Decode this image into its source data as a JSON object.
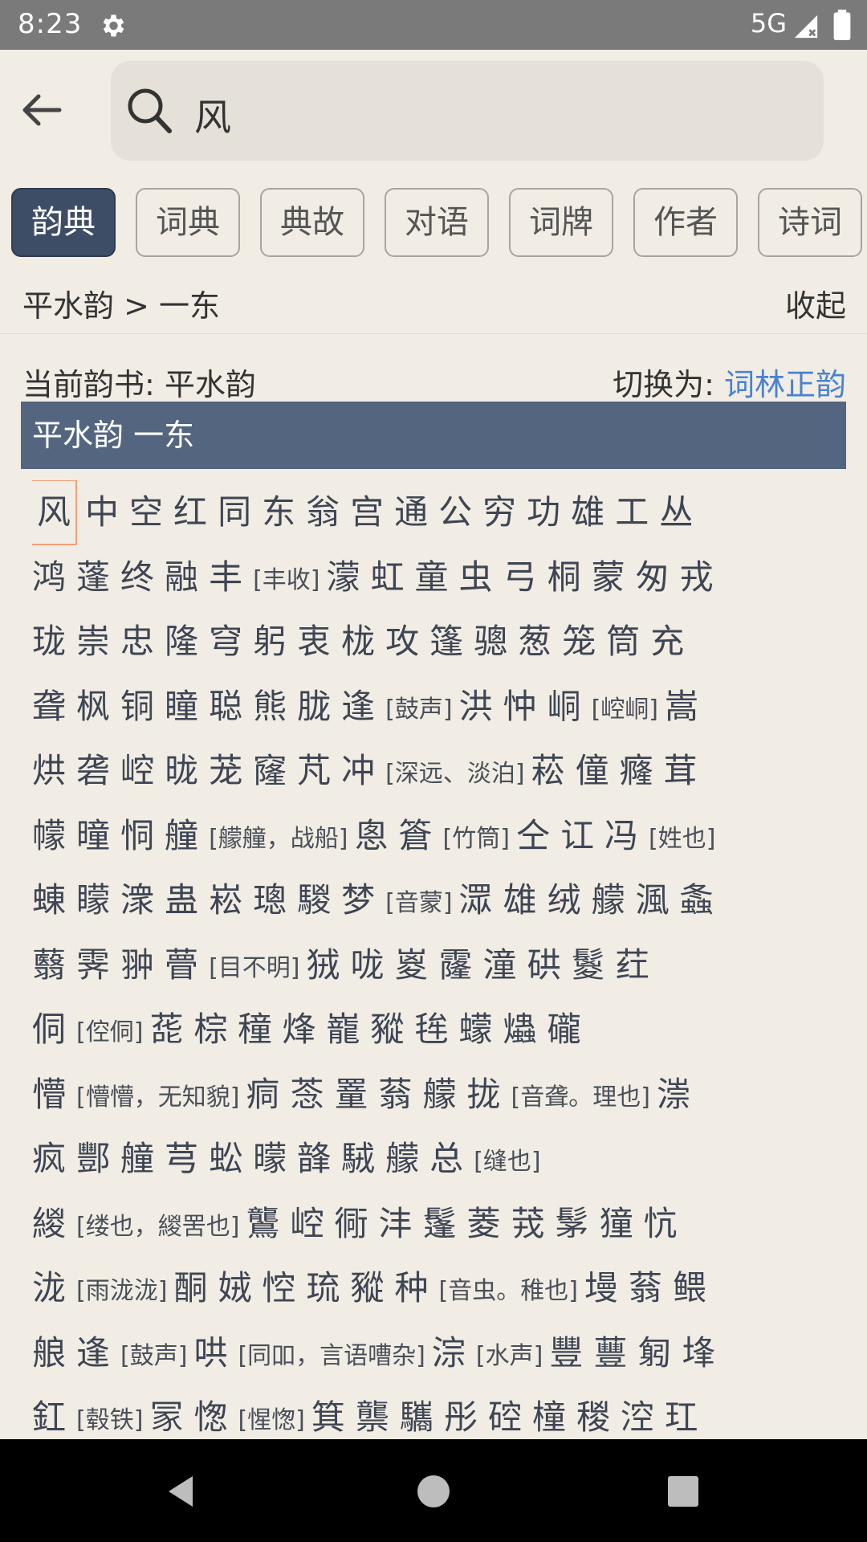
{
  "status": {
    "time": "8:23",
    "network": "5G"
  },
  "search": {
    "value": "风"
  },
  "tabs": [
    "韵典",
    "词典",
    "典故",
    "对语",
    "词牌",
    "作者",
    "诗词"
  ],
  "breadcrumb": "平水韵 > 一东",
  "collapse_label": "收起",
  "current_book": "当前韵书: 平水韵",
  "switch_label": "切换为:",
  "switch_link": "词林正韵",
  "section_title": "平水韵 一东",
  "rows": [
    [
      {
        "c": "风",
        "sel": true
      },
      {
        "c": "中"
      },
      {
        "c": "空"
      },
      {
        "c": "红"
      },
      {
        "c": "同"
      },
      {
        "c": "东"
      },
      {
        "c": "翁"
      },
      {
        "c": "宫"
      },
      {
        "c": "通"
      },
      {
        "c": "公"
      },
      {
        "c": "穷"
      },
      {
        "c": "功"
      },
      {
        "c": "雄"
      },
      {
        "c": "工"
      },
      {
        "c": "丛"
      }
    ],
    [
      {
        "c": "鸿"
      },
      {
        "c": "蓬"
      },
      {
        "c": "终"
      },
      {
        "c": "融"
      },
      {
        "c": "丰"
      },
      {
        "n": "[丰收]"
      },
      {
        "c": "濛"
      },
      {
        "c": "虹"
      },
      {
        "c": "童"
      },
      {
        "c": "虫"
      },
      {
        "c": "弓"
      },
      {
        "c": "桐"
      },
      {
        "c": "蒙"
      },
      {
        "c": "匆"
      },
      {
        "c": "戎"
      }
    ],
    [
      {
        "c": "珑"
      },
      {
        "c": "崇"
      },
      {
        "c": "忠"
      },
      {
        "c": "隆"
      },
      {
        "c": "穹"
      },
      {
        "c": "躬"
      },
      {
        "c": "衷"
      },
      {
        "c": "栊"
      },
      {
        "c": "攻"
      },
      {
        "c": "篷"
      },
      {
        "c": "骢"
      },
      {
        "c": "葱"
      },
      {
        "c": "笼"
      },
      {
        "c": "筒"
      },
      {
        "c": "充"
      }
    ],
    [
      {
        "c": "聋"
      },
      {
        "c": "枫"
      },
      {
        "c": "铜"
      },
      {
        "c": "瞳"
      },
      {
        "c": "聪"
      },
      {
        "c": "熊"
      },
      {
        "c": "胧"
      },
      {
        "c": "逢"
      },
      {
        "n": "[鼓声]"
      },
      {
        "c": "洪"
      },
      {
        "c": "忡"
      },
      {
        "c": "峒"
      },
      {
        "n": "[崆峒]"
      },
      {
        "c": "嵩"
      }
    ],
    [
      {
        "c": "烘"
      },
      {
        "c": "砻"
      },
      {
        "c": "崆"
      },
      {
        "c": "昽"
      },
      {
        "c": "茏"
      },
      {
        "c": "窿"
      },
      {
        "c": "芃"
      },
      {
        "c": "冲"
      },
      {
        "n": "[深远、淡泊]"
      },
      {
        "c": "菘"
      },
      {
        "c": "僮"
      },
      {
        "c": "癃"
      },
      {
        "c": "茸"
      }
    ],
    [
      {
        "c": "幪"
      },
      {
        "c": "曈"
      },
      {
        "c": "恫"
      },
      {
        "c": "艟"
      },
      {
        "n": "[艨艟，战船]"
      },
      {
        "c": "悤"
      },
      {
        "c": "篬"
      },
      {
        "n": "[竹筒]"
      },
      {
        "c": "仝"
      },
      {
        "c": "讧"
      },
      {
        "c": "冯"
      },
      {
        "n": "[姓也]"
      }
    ],
    [
      {
        "c": "蝀"
      },
      {
        "c": "矇"
      },
      {
        "c": "潨"
      },
      {
        "c": "蛊"
      },
      {
        "c": "崧"
      },
      {
        "c": "璁"
      },
      {
        "c": "騣"
      },
      {
        "c": "梦"
      },
      {
        "n": "[音蒙]"
      },
      {
        "c": "潀"
      },
      {
        "c": "雄"
      },
      {
        "c": "绒"
      },
      {
        "c": "艨"
      },
      {
        "c": "渢"
      },
      {
        "c": "螽"
      }
    ],
    [
      {
        "c": "蘙"
      },
      {
        "c": "霁"
      },
      {
        "c": "翀"
      },
      {
        "c": "瞢"
      },
      {
        "n": "[目不明]"
      },
      {
        "c": "狨"
      },
      {
        "c": "咙"
      },
      {
        "c": "嵏"
      },
      {
        "c": "霳"
      },
      {
        "c": "潼"
      },
      {
        "c": "硔"
      },
      {
        "c": "鬉"
      },
      {
        "c": "荭"
      }
    ],
    [
      {
        "c": "侗"
      },
      {
        "n": "[倥侗]"
      },
      {
        "c": "蒊"
      },
      {
        "c": "棕"
      },
      {
        "c": "穜"
      },
      {
        "c": "烽"
      },
      {
        "c": "巃"
      },
      {
        "c": "豵"
      },
      {
        "c": "毪"
      },
      {
        "c": "蠓"
      },
      {
        "c": "爞"
      },
      {
        "c": "礲"
      }
    ],
    [
      {
        "c": "懵"
      },
      {
        "n": "[懵懵，无知貌]"
      },
      {
        "c": "痌"
      },
      {
        "c": "菍"
      },
      {
        "c": "罿"
      },
      {
        "c": "蓊"
      },
      {
        "c": "艨"
      },
      {
        "c": "拢"
      },
      {
        "n": "[音聋。理也]"
      },
      {
        "c": "漴"
      }
    ],
    [
      {
        "c": "疯"
      },
      {
        "c": "酆"
      },
      {
        "c": "艟"
      },
      {
        "c": "芎"
      },
      {
        "c": "蚣"
      },
      {
        "c": "曚"
      },
      {
        "c": "韸"
      },
      {
        "c": "駥"
      },
      {
        "c": "艨"
      },
      {
        "c": "总"
      },
      {
        "n": "[缝也]"
      }
    ],
    [
      {
        "c": "緵"
      },
      {
        "n": "[缕也，緵罟也]"
      },
      {
        "c": "鸗"
      },
      {
        "c": "崆"
      },
      {
        "c": "衕"
      },
      {
        "c": "沣"
      },
      {
        "c": "鬔"
      },
      {
        "c": "菱"
      },
      {
        "c": "茙"
      },
      {
        "c": "髳"
      },
      {
        "c": "獞"
      },
      {
        "c": "忼"
      }
    ],
    [
      {
        "c": "泷"
      },
      {
        "n": "[雨泷泷]"
      },
      {
        "c": "酮"
      },
      {
        "c": "娀"
      },
      {
        "c": "悾"
      },
      {
        "c": "琉"
      },
      {
        "c": "豵"
      },
      {
        "c": "种"
      },
      {
        "n": "[音虫。稚也]"
      },
      {
        "c": "墁"
      },
      {
        "c": "蓊"
      },
      {
        "c": "鳂"
      }
    ],
    [
      {
        "c": "艆"
      },
      {
        "c": "逢"
      },
      {
        "n": "[鼓声]"
      },
      {
        "c": "哄"
      },
      {
        "n": "[同吅，言语嘈杂]"
      },
      {
        "c": "淙"
      },
      {
        "n": "[水声]"
      },
      {
        "c": "豐"
      },
      {
        "c": "蘴"
      },
      {
        "c": "匑"
      },
      {
        "c": "埄"
      }
    ],
    [
      {
        "c": "釭"
      },
      {
        "n": "[毂铁]"
      },
      {
        "c": "冡"
      },
      {
        "c": "愡"
      },
      {
        "n": "[惺愡]"
      },
      {
        "c": "箕"
      },
      {
        "c": "龒"
      },
      {
        "c": "驨"
      },
      {
        "c": "彤"
      },
      {
        "c": "硿"
      },
      {
        "c": "橦"
      },
      {
        "c": "稯"
      },
      {
        "c": "涳"
      },
      {
        "c": "玒"
      }
    ]
  ]
}
